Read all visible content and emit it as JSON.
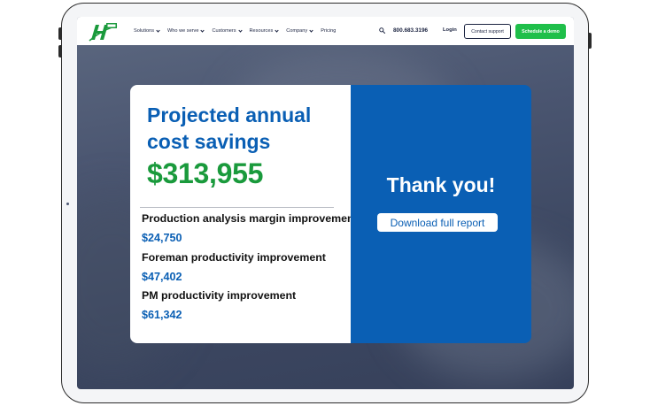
{
  "nav": {
    "items": [
      {
        "label": "Solutions"
      },
      {
        "label": "Who we serve"
      },
      {
        "label": "Customers"
      },
      {
        "label": "Resources"
      },
      {
        "label": "Company"
      },
      {
        "label": "Pricing"
      }
    ],
    "phone": "800.683.3196",
    "login": "Login",
    "contact_label": "Contact support",
    "demo_label": "Schedule a demo"
  },
  "results": {
    "title": "Projected annual cost savings",
    "total": "$313,955",
    "metrics": [
      {
        "label": "Production analysis margin improvement",
        "value": "$24,750"
      },
      {
        "label": "Foreman productivity improvement",
        "value": "$47,402"
      },
      {
        "label": "PM productivity improvement",
        "value": "$61,342"
      }
    ]
  },
  "cta": {
    "thanks": "Thank you!",
    "download_label": "Download full report"
  },
  "colors": {
    "brand_blue": "#0a5fb4",
    "brand_green": "#1a9a3c",
    "demo_green": "#1fbf4a"
  },
  "icons": [
    "hcss-logo-icon",
    "search-icon",
    "chevron-down-icon"
  ]
}
